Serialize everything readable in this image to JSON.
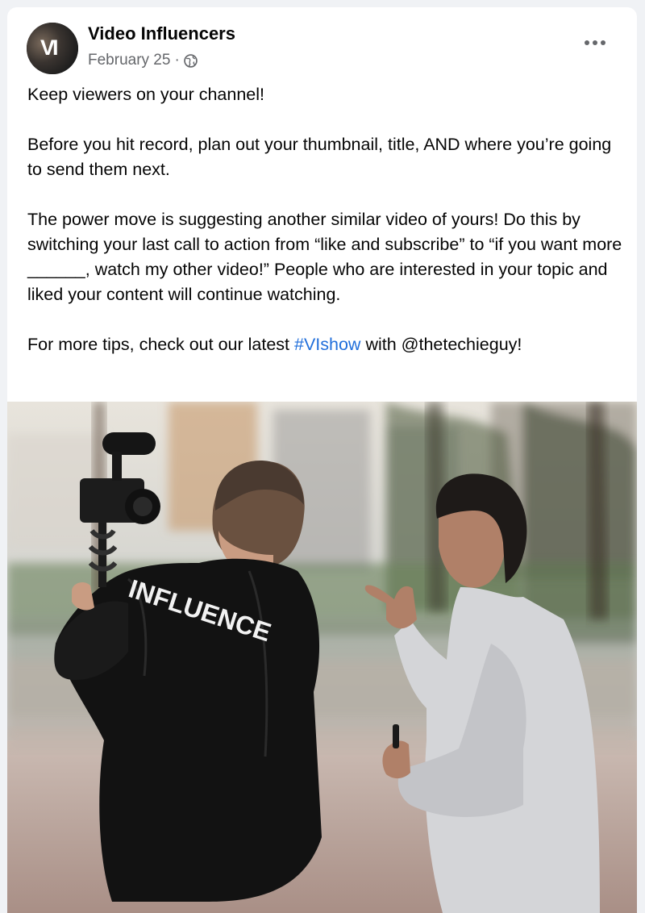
{
  "post": {
    "page_name": "Video Influencers",
    "avatar_initials": "VI",
    "date": "February 25",
    "separator": "·",
    "visibility_icon": "globe-icon",
    "more_icon": "more-options-icon",
    "paragraphs": [
      "Keep viewers on your channel!",
      "Before you hit record, plan out your thumbnail, title, AND where you’re going to send them next.",
      "The power move is suggesting another similar video of yours! Do this by switching your last call to action from “like and subscribe” to “if you want more ______, watch my other video!” People who are interested in your topic and liked your content will continue watching."
    ],
    "last_line": {
      "before": "For more tips, check out our latest ",
      "hashtag": "#VIshow",
      "after": " with @thetechieguy!"
    },
    "image": {
      "jacket_text": "INFLUENCE"
    }
  },
  "colors": {
    "link": "#216fdb",
    "secondary_text": "#65676b",
    "primary_text": "#050505",
    "background": "#f0f2f5"
  }
}
